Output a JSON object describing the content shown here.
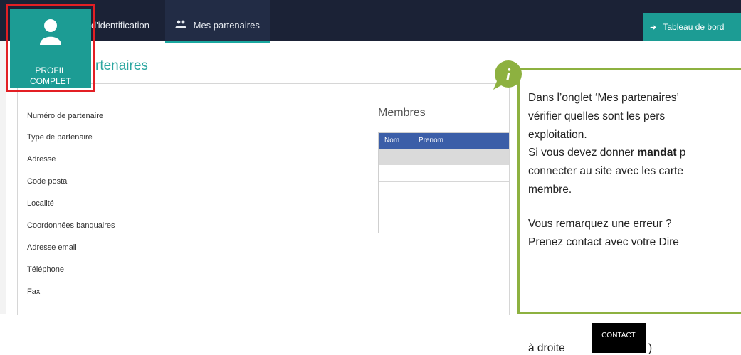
{
  "nav": {
    "tab_identification": "d'identification",
    "tab_partenaires": "Mes partenaires",
    "dashboard": "Tableau de bord"
  },
  "profile": {
    "line1": "PROFIL",
    "line2": "COMPLET"
  },
  "page": {
    "title": "rtenaires"
  },
  "fields": [
    "Numéro de partenaire",
    "Type de partenaire",
    "Adresse",
    "Code postal",
    "Localité",
    "Coordonnées banquaires",
    "Adresse email",
    "Téléphone",
    "Fax"
  ],
  "membres": {
    "title": "Membres",
    "col_nom": "Nom",
    "col_prenom": "Prenom"
  },
  "callout": {
    "info_symbol": "i",
    "l1_a": "Dans l’onglet ‘",
    "l1_b": "Mes partenaires",
    "l1_c": "’",
    "l2": "vérifier  quelles  sont  les  pers",
    "l3": "exploitation.",
    "l4_a": "Si vous devez donner ",
    "l4_b": "mandat",
    "l4_c": " p",
    "l5": "connecter au site avec les carte",
    "l6": "membre.",
    "l7_a": "Vous remarquez une erreur",
    "l7_b": " ?",
    "l8": "Prenez contact avec votre Dire",
    "l9_a": "à droite",
    "l9_b": ")",
    "contact_label": "CONTACT"
  },
  "colors": {
    "topbar": "#1b2236",
    "teal": "#1c9c94",
    "highlight_border": "#e31f24",
    "callout_border": "#8db140",
    "table_header": "#3b5ea8"
  }
}
